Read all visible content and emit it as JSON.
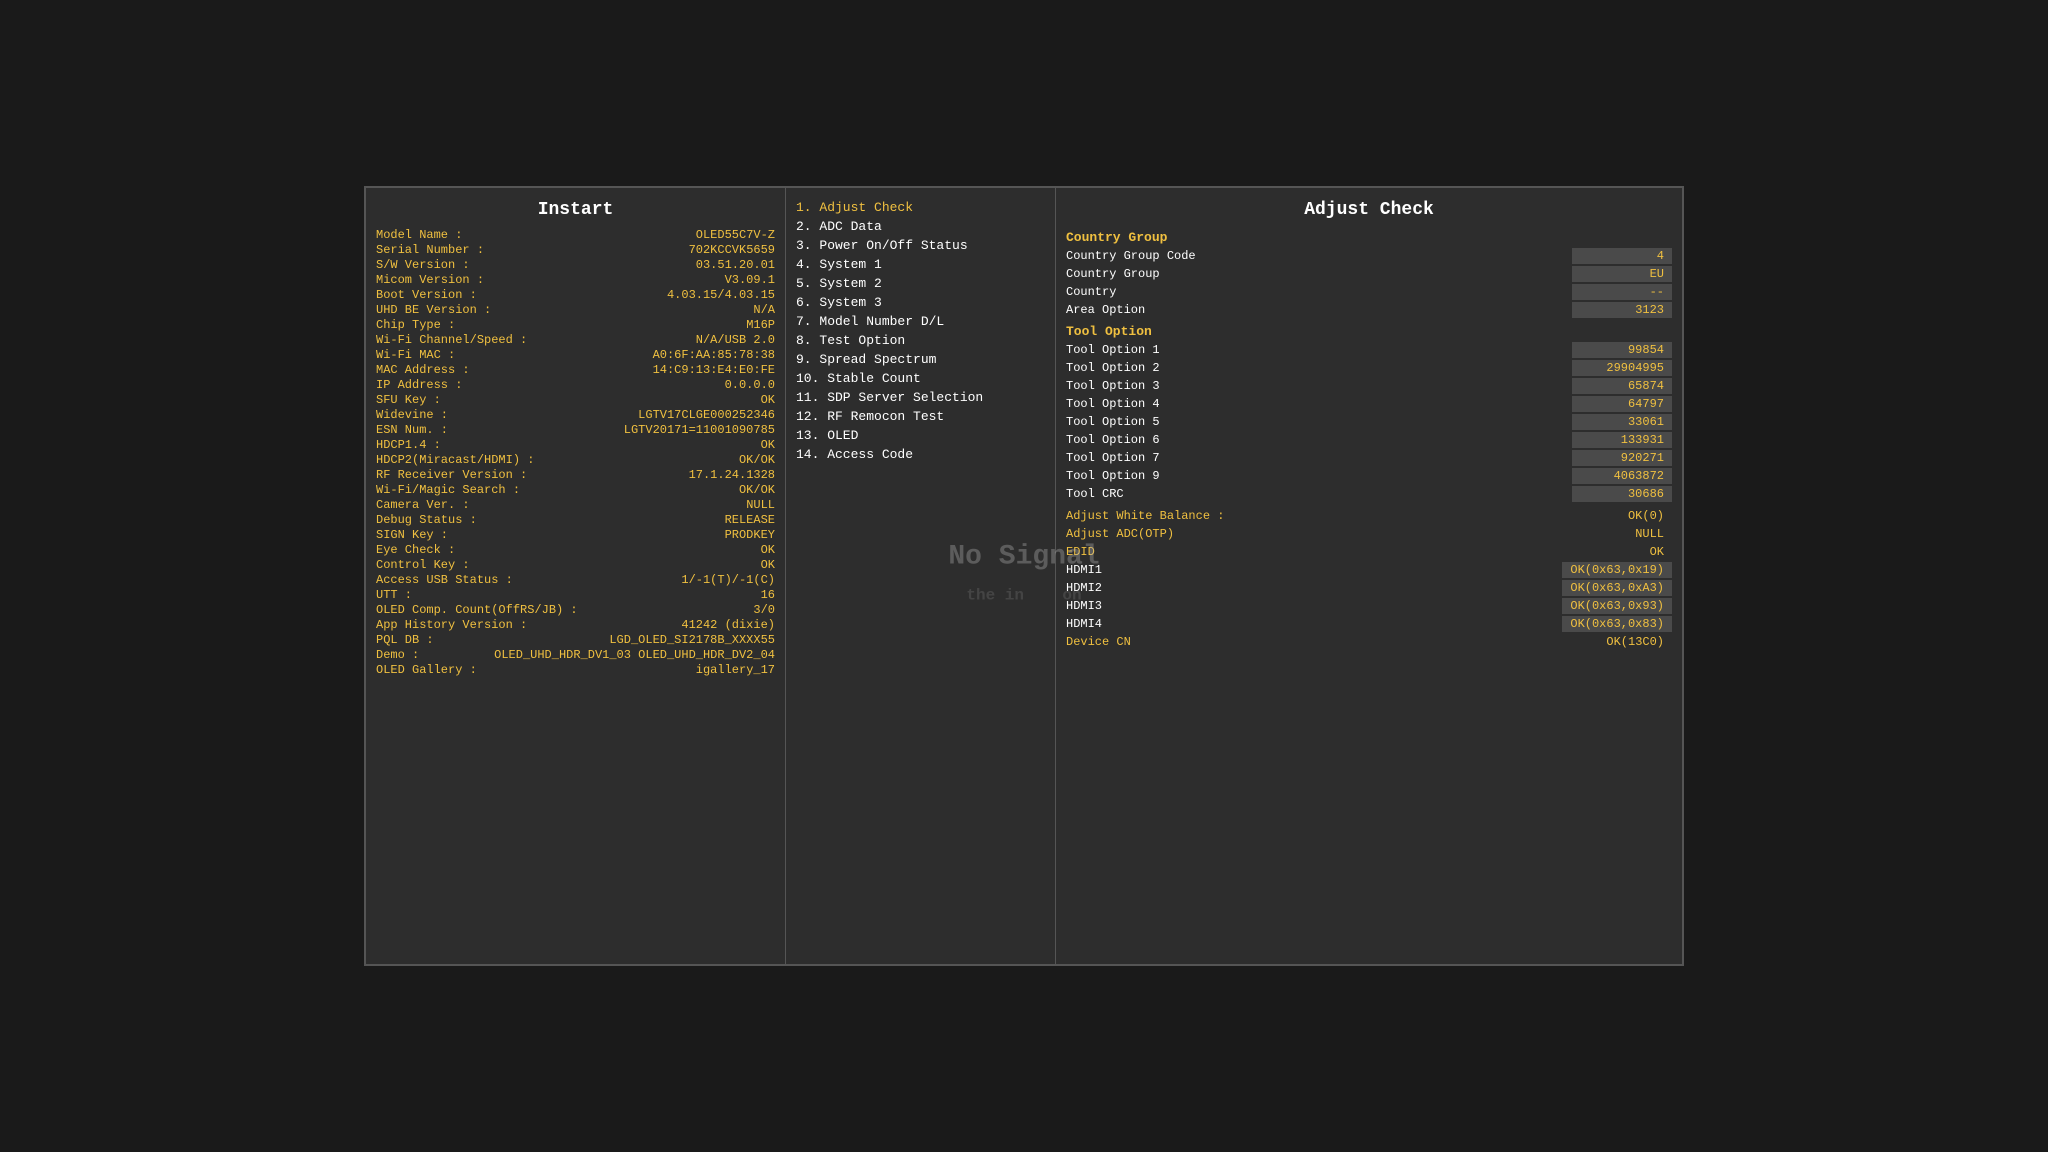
{
  "left": {
    "title": "Instart",
    "rows": [
      {
        "label": "Model Name :",
        "value": "OLED55C7V-Z"
      },
      {
        "label": "Serial Number :",
        "value": "702KCCVK5659"
      },
      {
        "label": "S/W Version :",
        "value": "03.51.20.01"
      },
      {
        "label": "Micom Version :",
        "value": "V3.09.1"
      },
      {
        "label": "Boot Version :",
        "value": "4.03.15/4.03.15"
      },
      {
        "label": "UHD BE Version :",
        "value": "N/A"
      },
      {
        "label": "Chip Type :",
        "value": "M16P"
      },
      {
        "label": "Wi-Fi Channel/Speed :",
        "value": "N/A/USB 2.0"
      },
      {
        "label": "Wi-Fi MAC :",
        "value": "A0:6F:AA:85:78:38"
      },
      {
        "label": "MAC Address :",
        "value": "14:C9:13:E4:E0:FE"
      },
      {
        "label": "IP Address :",
        "value": "0.0.0.0"
      },
      {
        "label": "SFU Key :",
        "value": "OK"
      },
      {
        "label": "Widevine :",
        "value": "LGTV17CLGE000252346"
      },
      {
        "label": "ESN Num. :",
        "value": "LGTV20171=11001090785"
      },
      {
        "label": "HDCP1.4 :",
        "value": "OK"
      },
      {
        "label": "HDCP2(Miracast/HDMI) :",
        "value": "OK/OK"
      },
      {
        "label": "RF Receiver Version :",
        "value": "17.1.24.1328"
      },
      {
        "label": "Wi-Fi/Magic Search :",
        "value": "OK/OK"
      },
      {
        "label": "Camera Ver. :",
        "value": "NULL"
      },
      {
        "label": "Debug Status :",
        "value": "RELEASE"
      },
      {
        "label": "SIGN Key :",
        "value": "PRODKEY"
      },
      {
        "label": "Eye Check :",
        "value": "OK"
      },
      {
        "label": "Control Key :",
        "value": "OK"
      },
      {
        "label": "Access USB Status :",
        "value": "1/-1(T)/-1(C)"
      },
      {
        "label": "UTT :",
        "value": "16"
      },
      {
        "label": "OLED Comp. Count(OffRS/JB) :",
        "value": "3/0"
      },
      {
        "label": "App History Version :",
        "value": "41242 (dixie)"
      },
      {
        "label": "PQL DB :",
        "value": "LGD_OLED_SI2178B_XXXX55"
      },
      {
        "label": "Demo :",
        "value": "OLED_UHD_HDR_DV1_03 OLED_UHD_HDR_DV2_04"
      },
      {
        "label": "OLED Gallery :",
        "value": "igallery_17"
      }
    ]
  },
  "mid": {
    "items": [
      {
        "label": "1. Adjust Check",
        "active": true
      },
      {
        "label": "2. ADC Data",
        "active": false
      },
      {
        "label": "3. Power On/Off Status",
        "active": false
      },
      {
        "label": "4. System 1",
        "active": false
      },
      {
        "label": "5. System 2",
        "active": false
      },
      {
        "label": "6. System 3",
        "active": false
      },
      {
        "label": "7. Model Number D/L",
        "active": false
      },
      {
        "label": "8. Test Option",
        "active": false
      },
      {
        "label": "9. Spread Spectrum",
        "active": false
      },
      {
        "label": "10. Stable Count",
        "active": false
      },
      {
        "label": "11. SDP Server Selection",
        "active": false
      },
      {
        "label": "12. RF Remocon Test",
        "active": false
      },
      {
        "label": "13. OLED",
        "active": false
      },
      {
        "label": "14. Access Code",
        "active": false
      }
    ]
  },
  "right": {
    "title": "Adjust Check",
    "sections": [
      {
        "title": "Country Group",
        "rows": [
          {
            "label": "Country Group Code",
            "value": "4",
            "labelYellow": false,
            "valueBg": true
          },
          {
            "label": "Country Group",
            "value": "EU",
            "labelYellow": false,
            "valueBg": true
          },
          {
            "label": "Country",
            "value": "--",
            "labelYellow": false,
            "valueBg": true
          },
          {
            "label": "Area Option",
            "value": "3123",
            "labelYellow": false,
            "valueBg": true
          }
        ]
      },
      {
        "title": "Tool Option",
        "rows": [
          {
            "label": "Tool Option 1",
            "value": "99854",
            "labelYellow": false,
            "valueBg": true
          },
          {
            "label": "Tool Option 2",
            "value": "29904995",
            "labelYellow": false,
            "valueBg": true
          },
          {
            "label": "Tool Option 3",
            "value": "65874",
            "labelYellow": false,
            "valueBg": true
          },
          {
            "label": "Tool Option 4",
            "value": "64797",
            "labelYellow": false,
            "valueBg": true
          },
          {
            "label": "Tool Option 5",
            "value": "33061",
            "labelYellow": false,
            "valueBg": true
          },
          {
            "label": "Tool Option 6",
            "value": "133931",
            "labelYellow": false,
            "valueBg": true
          },
          {
            "label": "Tool Option 7",
            "value": "920271",
            "labelYellow": false,
            "valueBg": true
          },
          {
            "label": "Tool Option 9",
            "value": "4063872",
            "labelYellow": false,
            "valueBg": true
          },
          {
            "label": "Tool CRC",
            "value": "30686",
            "labelYellow": false,
            "valueBg": true
          }
        ]
      },
      {
        "title": "",
        "rows": [
          {
            "label": "Adjust White Balance :",
            "value": "OK(0)",
            "labelYellow": true,
            "valueBg": false
          },
          {
            "label": "Adjust ADC(OTP)",
            "value": "NULL",
            "labelYellow": true,
            "valueBg": false
          },
          {
            "label": "EDID",
            "value": "OK",
            "labelYellow": true,
            "valueBg": false
          },
          {
            "label": "HDMI1",
            "value": "OK(0x63,0x19)",
            "labelYellow": false,
            "valueBg": true
          },
          {
            "label": "HDMI2",
            "value": "OK(0x63,0xA3)",
            "labelYellow": false,
            "valueBg": true
          },
          {
            "label": "HDMI3",
            "value": "OK(0x63,0x93)",
            "labelYellow": false,
            "valueBg": true
          },
          {
            "label": "HDMI4",
            "value": "OK(0x63,0x83)",
            "labelYellow": false,
            "valueBg": true
          },
          {
            "label": "Device CN",
            "value": "OK(13C0)",
            "labelYellow": true,
            "valueBg": false
          }
        ]
      }
    ],
    "watermark": "No Signal\nthe in   on"
  }
}
